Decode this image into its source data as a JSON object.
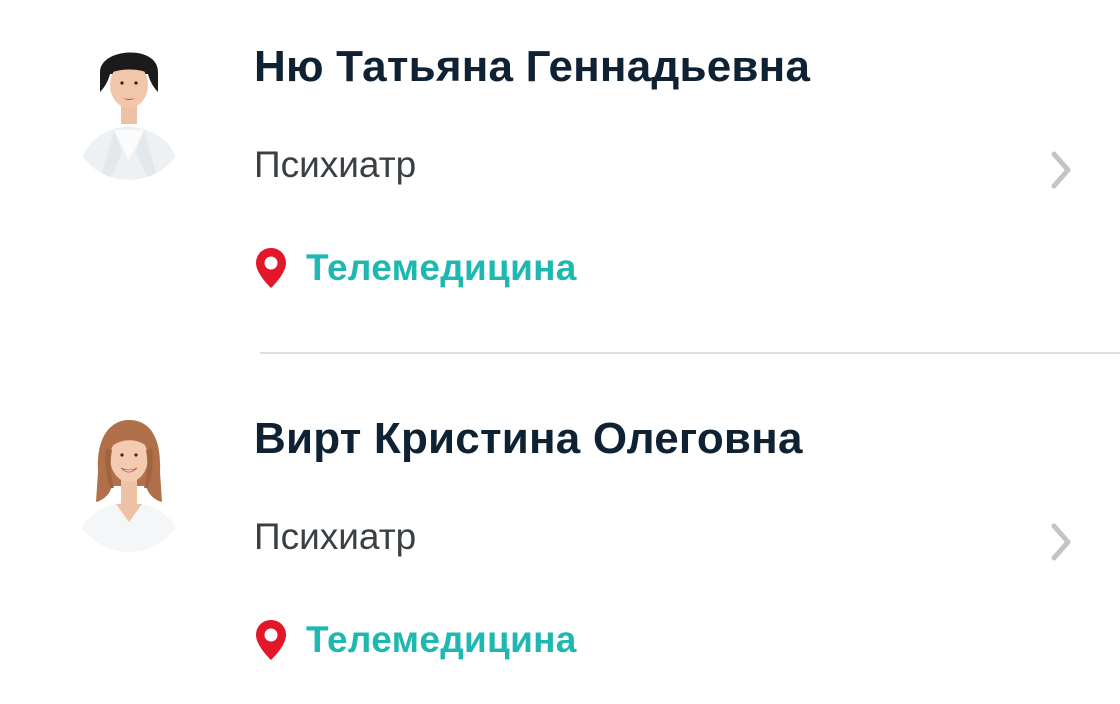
{
  "doctors": [
    {
      "name": "Ню Татьяна Геннадьевна",
      "specialty": "Психиатр",
      "location": "Телемедицина"
    },
    {
      "name": "Вирт Кристина Олеговна",
      "specialty": "Психиатр",
      "location": "Телемедицина"
    }
  ],
  "colors": {
    "name": "#0e2233",
    "specialty": "#3a3f44",
    "location_text": "#1fb8b1",
    "pin": "#e3162a",
    "chevron": "#c4c4c4",
    "divider": "#dedede"
  },
  "icons": {
    "location": "map-pin-icon",
    "navigate": "chevron-right-icon"
  }
}
